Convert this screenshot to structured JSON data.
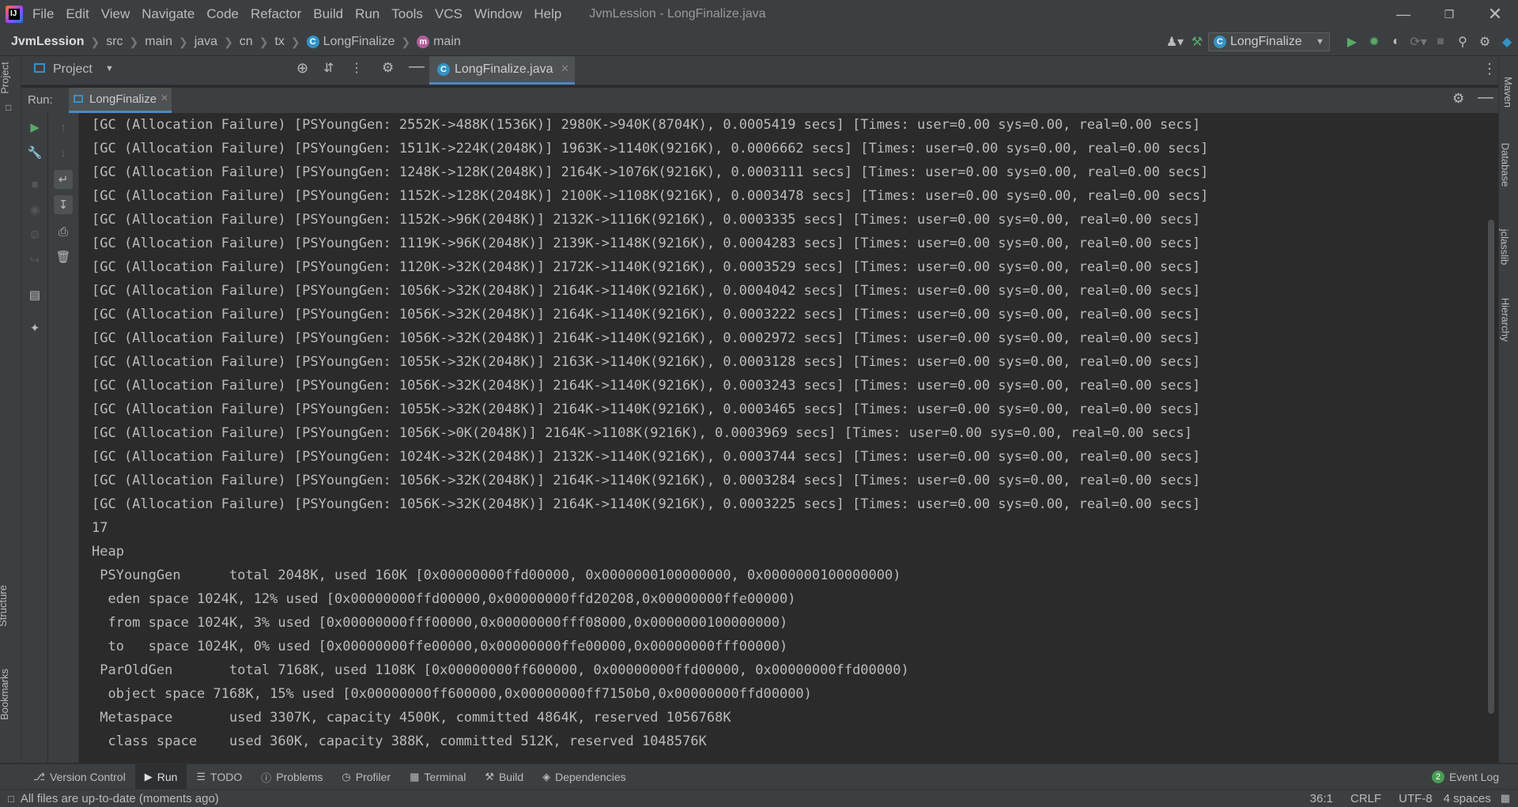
{
  "menubar": {
    "items": [
      "File",
      "Edit",
      "View",
      "Navigate",
      "Code",
      "Refactor",
      "Build",
      "Run",
      "Tools",
      "VCS",
      "Window",
      "Help"
    ],
    "title": "JvmLession - LongFinalize.java",
    "logo_text": "IJ"
  },
  "navbar": {
    "breadcrumbs": [
      "JvmLession",
      "src",
      "main",
      "java",
      "cn",
      "tx",
      "LongFinalize",
      "main"
    ],
    "run_config": "LongFinalize"
  },
  "project_panel": {
    "label": "Project",
    "editor_tab": "LongFinalize.java"
  },
  "run_panel": {
    "label": "Run:",
    "tab": "LongFinalize"
  },
  "left_strip": {
    "top_label": "Project",
    "structure_label": "Structure",
    "bookmarks_label": "Bookmarks"
  },
  "right_strip": {
    "maven": "Maven",
    "database": "Database",
    "jclasslib": "jclasslib",
    "hierarchy": "Hierarchy"
  },
  "console_lines": [
    "[GC (Allocation Failure) [PSYoungGen: 2552K->488K(1536K)] 2980K->940K(8704K), 0.0005419 secs] [Times: user=0.00 sys=0.00, real=0.00 secs]",
    "[GC (Allocation Failure) [PSYoungGen: 1511K->224K(2048K)] 1963K->1140K(9216K), 0.0006662 secs] [Times: user=0.00 sys=0.00, real=0.00 secs]",
    "[GC (Allocation Failure) [PSYoungGen: 1248K->128K(2048K)] 2164K->1076K(9216K), 0.0003111 secs] [Times: user=0.00 sys=0.00, real=0.00 secs]",
    "[GC (Allocation Failure) [PSYoungGen: 1152K->128K(2048K)] 2100K->1108K(9216K), 0.0003478 secs] [Times: user=0.00 sys=0.00, real=0.00 secs]",
    "[GC (Allocation Failure) [PSYoungGen: 1152K->96K(2048K)] 2132K->1116K(9216K), 0.0003335 secs] [Times: user=0.00 sys=0.00, real=0.00 secs]",
    "[GC (Allocation Failure) [PSYoungGen: 1119K->96K(2048K)] 2139K->1148K(9216K), 0.0004283 secs] [Times: user=0.00 sys=0.00, real=0.00 secs]",
    "[GC (Allocation Failure) [PSYoungGen: 1120K->32K(2048K)] 2172K->1140K(9216K), 0.0003529 secs] [Times: user=0.00 sys=0.00, real=0.00 secs]",
    "[GC (Allocation Failure) [PSYoungGen: 1056K->32K(2048K)] 2164K->1140K(9216K), 0.0004042 secs] [Times: user=0.00 sys=0.00, real=0.00 secs]",
    "[GC (Allocation Failure) [PSYoungGen: 1056K->32K(2048K)] 2164K->1140K(9216K), 0.0003222 secs] [Times: user=0.00 sys=0.00, real=0.00 secs]",
    "[GC (Allocation Failure) [PSYoungGen: 1056K->32K(2048K)] 2164K->1140K(9216K), 0.0002972 secs] [Times: user=0.00 sys=0.00, real=0.00 secs]",
    "[GC (Allocation Failure) [PSYoungGen: 1055K->32K(2048K)] 2163K->1140K(9216K), 0.0003128 secs] [Times: user=0.00 sys=0.00, real=0.00 secs]",
    "[GC (Allocation Failure) [PSYoungGen: 1056K->32K(2048K)] 2164K->1140K(9216K), 0.0003243 secs] [Times: user=0.00 sys=0.00, real=0.00 secs]",
    "[GC (Allocation Failure) [PSYoungGen: 1055K->32K(2048K)] 2164K->1140K(9216K), 0.0003465 secs] [Times: user=0.00 sys=0.00, real=0.00 secs]",
    "[GC (Allocation Failure) [PSYoungGen: 1056K->0K(2048K)] 2164K->1108K(9216K), 0.0003969 secs] [Times: user=0.00 sys=0.00, real=0.00 secs]",
    "[GC (Allocation Failure) [PSYoungGen: 1024K->32K(2048K)] 2132K->1140K(9216K), 0.0003744 secs] [Times: user=0.00 sys=0.00, real=0.00 secs]",
    "[GC (Allocation Failure) [PSYoungGen: 1056K->32K(2048K)] 2164K->1140K(9216K), 0.0003284 secs] [Times: user=0.00 sys=0.00, real=0.00 secs]",
    "[GC (Allocation Failure) [PSYoungGen: 1056K->32K(2048K)] 2164K->1140K(9216K), 0.0003225 secs] [Times: user=0.00 sys=0.00, real=0.00 secs]",
    "17",
    "Heap",
    " PSYoungGen      total 2048K, used 160K [0x00000000ffd00000, 0x0000000100000000, 0x0000000100000000)",
    "  eden space 1024K, 12% used [0x00000000ffd00000,0x00000000ffd20208,0x00000000ffe00000)",
    "  from space 1024K, 3% used [0x00000000fff00000,0x00000000fff08000,0x0000000100000000)",
    "  to   space 1024K, 0% used [0x00000000ffe00000,0x00000000ffe00000,0x00000000fff00000)",
    " ParOldGen       total 7168K, used 1108K [0x00000000ff600000, 0x00000000ffd00000, 0x00000000ffd00000)",
    "  object space 7168K, 15% used [0x00000000ff600000,0x00000000ff7150b0,0x00000000ffd00000)",
    " Metaspace       used 3307K, capacity 4500K, committed 4864K, reserved 1056768K",
    "  class space    used 360K, capacity 388K, committed 512K, reserved 1048576K"
  ],
  "bottom_tabs": [
    "Version Control",
    "Run",
    "TODO",
    "Problems",
    "Profiler",
    "Terminal",
    "Build",
    "Dependencies"
  ],
  "event_log": {
    "count": "2",
    "label": "Event Log"
  },
  "statusbar": {
    "message": "All files are up-to-date (moments ago)",
    "position": "36:1",
    "line_sep": "CRLF",
    "encoding": "UTF-8",
    "indent": "4 spaces"
  },
  "colors": {
    "bg": "#2b2b2b",
    "chrome": "#3c3f41",
    "run_green": "#59a869",
    "text": "#bbbbbb"
  }
}
